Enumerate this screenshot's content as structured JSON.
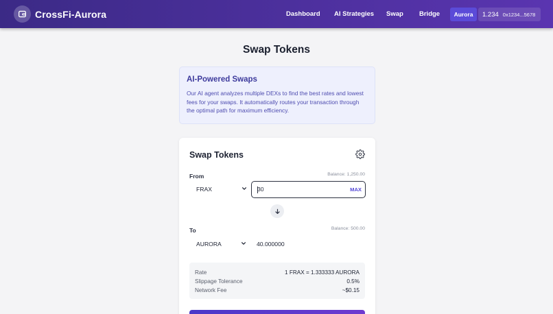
{
  "header": {
    "brand": "CrossFi-Aurora",
    "nav": [
      "Dashboard",
      "AI Strategies",
      "Swap",
      "Bridge"
    ],
    "network": "Aurora",
    "wallet_balance": "1.234",
    "wallet_address": "0x1234...5678"
  },
  "page": {
    "title": "Swap Tokens"
  },
  "info": {
    "title": "AI-Powered Swaps",
    "text": "Our AI agent analyzes multiple DEXs to find the best rates and lowest fees for your swaps. It automatically routes your transaction through the optimal path for maximum efficiency."
  },
  "swap": {
    "title": "Swap Tokens",
    "from_label": "From",
    "from_balance": "Balance: 1,250.00",
    "from_token": "FRAX",
    "from_amount": "30",
    "max_label": "MAX",
    "to_label": "To",
    "to_balance": "Balance: 500.00",
    "to_token": "AURORA",
    "to_amount": "40.000000",
    "details": [
      {
        "label": "Rate",
        "value": "1 FRAX = 1.333333 AURORA"
      },
      {
        "label": "Slippage Tolerance",
        "value": "0.5%"
      },
      {
        "label": "Network Fee",
        "value": "~$0.15"
      }
    ]
  },
  "colors": {
    "accent": "#5448d6",
    "header_start": "#3b2a86",
    "header_end": "#5a35b0"
  }
}
